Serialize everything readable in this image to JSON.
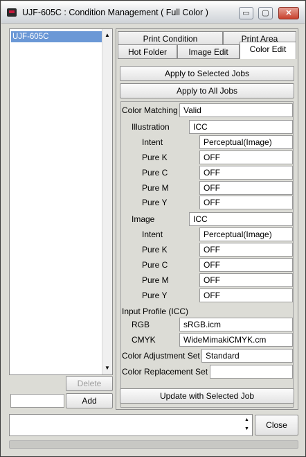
{
  "window": {
    "title": "UJF-605C : Condition Management ( Full Color )"
  },
  "title_buttons": {
    "minimize": "▭",
    "maximize": "▢",
    "close": "✕"
  },
  "left": {
    "items": [
      "UJF-605C"
    ],
    "delete_label": "Delete",
    "add_label": "Add",
    "add_value": ""
  },
  "tabs": {
    "row1": [
      "Print Condition",
      "Print Area"
    ],
    "row2": [
      "Hot Folder",
      "Image Edit",
      "Color Edit"
    ],
    "active": "Color Edit"
  },
  "actions": {
    "apply_selected": "Apply to Selected Jobs",
    "apply_all": "Apply to All Jobs",
    "update_selected": "Update with Selected Job"
  },
  "form": {
    "color_matching": {
      "label": "Color Matching",
      "value": "Valid"
    },
    "illustration": {
      "label": "Illustration",
      "value": "ICC",
      "intent": {
        "label": "Intent",
        "value": "Perceptual(Image)"
      },
      "pure_k": {
        "label": "Pure K",
        "value": "OFF"
      },
      "pure_c": {
        "label": "Pure C",
        "value": "OFF"
      },
      "pure_m": {
        "label": "Pure M",
        "value": "OFF"
      },
      "pure_y": {
        "label": "Pure Y",
        "value": "OFF"
      }
    },
    "image": {
      "label": "Image",
      "value": "ICC",
      "intent": {
        "label": "Intent",
        "value": "Perceptual(Image)"
      },
      "pure_k": {
        "label": "Pure K",
        "value": "OFF"
      },
      "pure_c": {
        "label": "Pure C",
        "value": "OFF"
      },
      "pure_m": {
        "label": "Pure M",
        "value": "OFF"
      },
      "pure_y": {
        "label": "Pure Y",
        "value": "OFF"
      }
    },
    "input_profile": {
      "label": "Input Profile (ICC)",
      "rgb": {
        "label": "RGB",
        "value": "sRGB.icm"
      },
      "cmyk": {
        "label": "CMYK",
        "value": "WideMimakiCMYK.cm"
      }
    },
    "color_adjustment_set": {
      "label": "Color Adjustment Set",
      "value": "Standard"
    },
    "color_replacement_set": {
      "label": "Color Replacement Set",
      "value": ""
    }
  },
  "bottom": {
    "close_label": "Close",
    "message": ""
  },
  "colors": {
    "selection": "#6b98d6",
    "window_bg": "#dcdcd6"
  }
}
